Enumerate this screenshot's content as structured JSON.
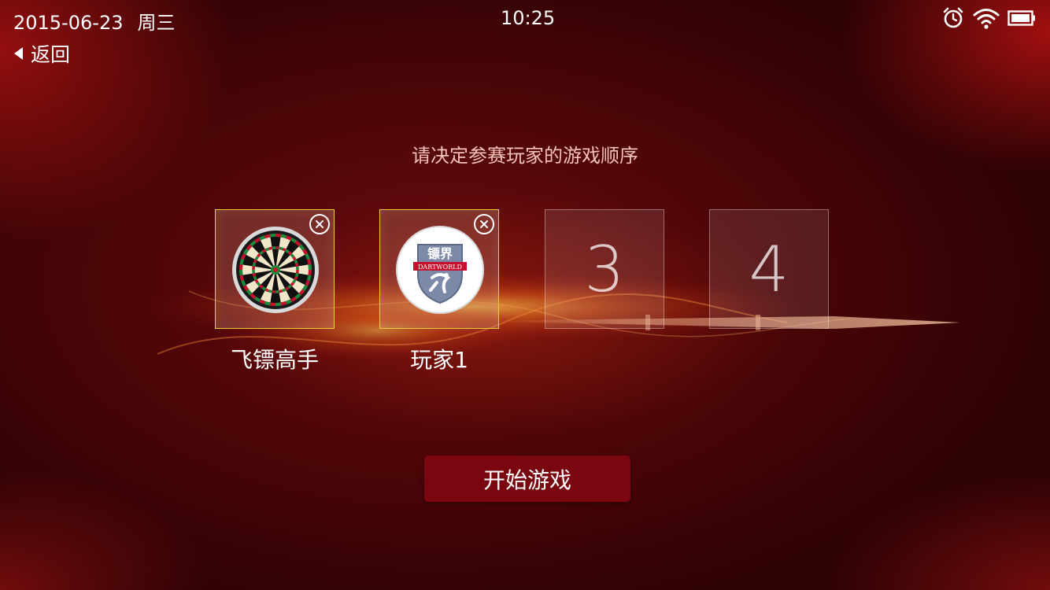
{
  "status_bar": {
    "date": "2015-06-23",
    "weekday": "周三",
    "time": "10:25",
    "icons": [
      "alarm-icon",
      "wifi-icon",
      "battery-icon"
    ]
  },
  "nav": {
    "back_label": "返回"
  },
  "prompt": "请决定参赛玩家的游戏顺序",
  "slots": [
    {
      "name": "飞镖高手",
      "avatar": "dartboard-avatar",
      "filled": true
    },
    {
      "name": "玩家1",
      "avatar": "dartworld-logo-avatar",
      "logo_text_cn": "镖界",
      "logo_text_en": "DARTWORLD",
      "filled": true
    },
    {
      "number": "3",
      "filled": false
    },
    {
      "number": "4",
      "filled": false
    }
  ],
  "start_button_label": "开始游戏",
  "colors": {
    "background": "#4a0507",
    "start_button": "#7a0710",
    "selected_border": "#e9cf38",
    "prompt_text": "#f4c3b8"
  }
}
